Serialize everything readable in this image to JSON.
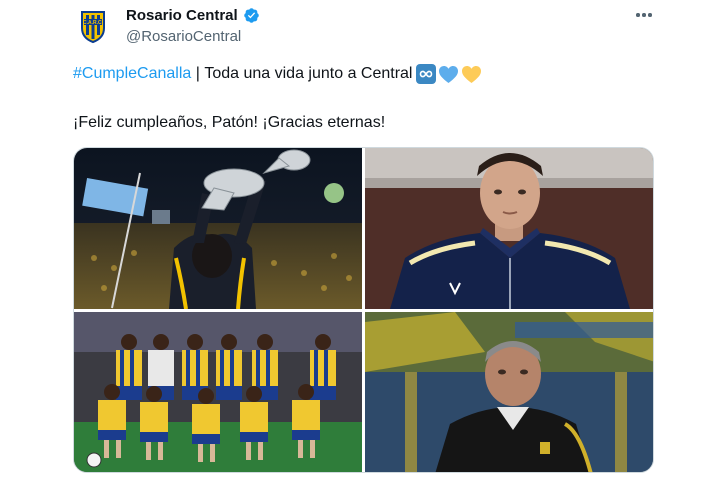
{
  "author": {
    "display_name": "Rosario Central",
    "handle": "@RosarioCentral",
    "verified_icon": "verified-badge-icon",
    "logo_colors": [
      "#0b3d91",
      "#f2c200"
    ]
  },
  "more_icon": "more-options-icon",
  "tweet": {
    "hashtag": "#CumpleCanalla",
    "separator": " | ",
    "line1_text": "Toda una vida junto a Central",
    "emojis": [
      "infinity-emoji",
      "blue-heart-emoji",
      "yellow-heart-emoji"
    ],
    "line2_text": "¡Feliz cumpleaños, Patón! ¡Gracias eternas!"
  },
  "photos": [
    {
      "name": "photo-trophy-celebration"
    },
    {
      "name": "photo-portrait-jacket"
    },
    {
      "name": "photo-team-lineup"
    },
    {
      "name": "photo-coach-stadium"
    }
  ],
  "colors": {
    "accent": "#1d9bf0",
    "text": "#0f1419",
    "secondary": "#536471",
    "club_blue": "#0b3d91",
    "club_yellow": "#f2c200"
  }
}
